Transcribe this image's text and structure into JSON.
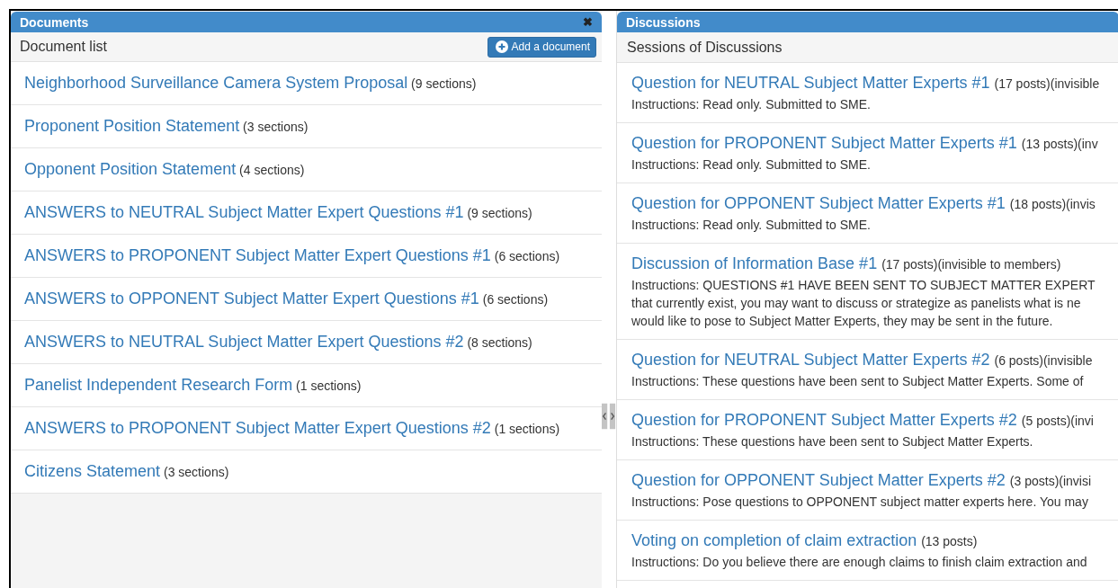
{
  "documents_panel": {
    "title": "Documents",
    "close": "✖",
    "subtitle": "Document list",
    "add_button": "Add a document",
    "items": [
      {
        "title": "Neighborhood Surveillance Camera System Proposal",
        "count": "(9 sections)"
      },
      {
        "title": "Proponent Position Statement",
        "count": "(3 sections)"
      },
      {
        "title": "Opponent Position Statement",
        "count": "(4 sections)"
      },
      {
        "title": "ANSWERS to NEUTRAL Subject Matter Expert Questions #1",
        "count": "(9 sections)"
      },
      {
        "title": "ANSWERS to PROPONENT Subject Matter Expert Questions #1",
        "count": "(6 sections)"
      },
      {
        "title": "ANSWERS to OPPONENT Subject Matter Expert Questions #1",
        "count": "(6 sections)"
      },
      {
        "title": "ANSWERS to NEUTRAL Subject Matter Expert Questions #2",
        "count": "(8 sections)"
      },
      {
        "title": "Panelist Independent Research Form",
        "count": "(1 sections)"
      },
      {
        "title": "ANSWERS to PROPONENT Subject Matter Expert Questions #2",
        "count": "(1 sections)"
      },
      {
        "title": "Citizens Statement",
        "count": "(3 sections)"
      }
    ]
  },
  "discussions_panel": {
    "title": "Discussions",
    "subtitle": "Sessions of Discussions",
    "items": [
      {
        "title": "Question for NEUTRAL Subject Matter Experts #1",
        "meta": "(17 posts)(invisible",
        "instructions": [
          "Instructions: Read only. Submitted to SME."
        ]
      },
      {
        "title": "Question for PROPONENT Subject Matter Experts #1",
        "meta": "(13 posts)(inv",
        "instructions": [
          "Instructions: Read only. Submitted to SME."
        ]
      },
      {
        "title": "Question for OPPONENT Subject Matter Experts #1",
        "meta": "(18 posts)(invis",
        "instructions": [
          "Instructions: Read only. Submitted to SME."
        ]
      },
      {
        "title": "Discussion of Information Base #1",
        "meta": "(17 posts)(invisible to members)",
        "instructions": [
          "Instructions: QUESTIONS #1 HAVE BEEN SENT TO SUBJECT MATTER EXPERT",
          "that currently exist, you may want to discuss or strategize as panelists what is ne",
          "would like to pose to Subject Matter Experts, they may be sent in the future."
        ]
      },
      {
        "title": "Question for NEUTRAL Subject Matter Experts #2",
        "meta": "(6 posts)(invisible",
        "instructions": [
          "Instructions: These questions have been sent to Subject Matter Experts. Some of"
        ]
      },
      {
        "title": "Question for PROPONENT Subject Matter Experts #2",
        "meta": "(5 posts)(invi",
        "instructions": [
          "Instructions: These questions have been sent to Subject Matter Experts."
        ]
      },
      {
        "title": "Question for OPPONENT Subject Matter Experts #2",
        "meta": "(3 posts)(invisi",
        "instructions": [
          "Instructions: Pose questions to OPPONENT subject matter experts here. You may"
        ]
      },
      {
        "title": "Voting on completion of claim extraction",
        "meta": "(13 posts)",
        "instructions": [
          "Instructions: Do you believe there are enough claims to finish claim extraction and"
        ]
      }
    ]
  }
}
